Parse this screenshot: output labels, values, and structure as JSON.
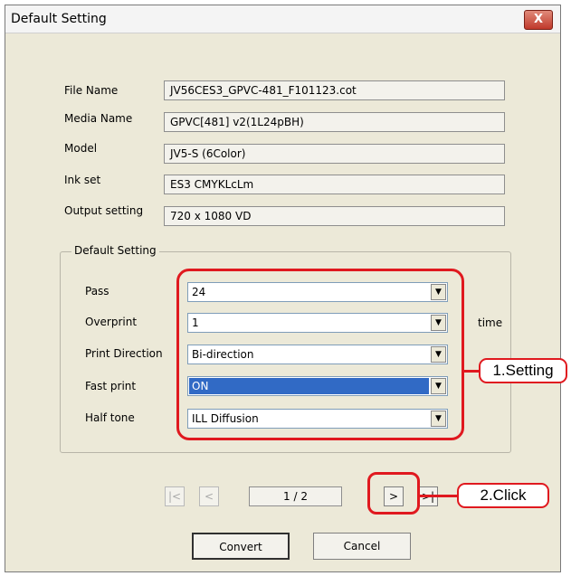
{
  "window": {
    "title": "Default Setting",
    "close_glyph": "X"
  },
  "info": {
    "file_name_label": "File Name",
    "file_name": "JV56CES3_GPVC-481_F101123.cot",
    "media_name_label": "Media Name",
    "media_name": "GPVC[481] v2(1L24pBH)",
    "model_label": "Model",
    "model": "JV5-S (6Color)",
    "ink_set_label": "Ink set",
    "ink_set": "ES3 CMYKLcLm",
    "output_setting_label": "Output setting",
    "output_setting": "720 x 1080 VD"
  },
  "group": {
    "title": "Default Setting",
    "pass_label": "Pass",
    "pass": "24",
    "overprint_label": "Overprint",
    "overprint": "1",
    "overprint_unit": "time",
    "print_direction_label": "Print Direction",
    "print_direction": "Bi-direction",
    "fast_print_label": "Fast print",
    "fast_print": "ON",
    "half_tone_label": "Half tone",
    "half_tone": "ILL Diffusion"
  },
  "paging": {
    "first": "|<",
    "prev": "<",
    "page": "1 / 2",
    "next": ">",
    "last": ">|"
  },
  "buttons": {
    "convert": "Convert",
    "cancel": "Cancel"
  },
  "annotations": {
    "setting": "1.Setting",
    "click": "2.Click"
  },
  "icons": {
    "arrow": "▼"
  },
  "colors": {
    "annotation": "#e0191f",
    "selection": "#316ac5"
  }
}
